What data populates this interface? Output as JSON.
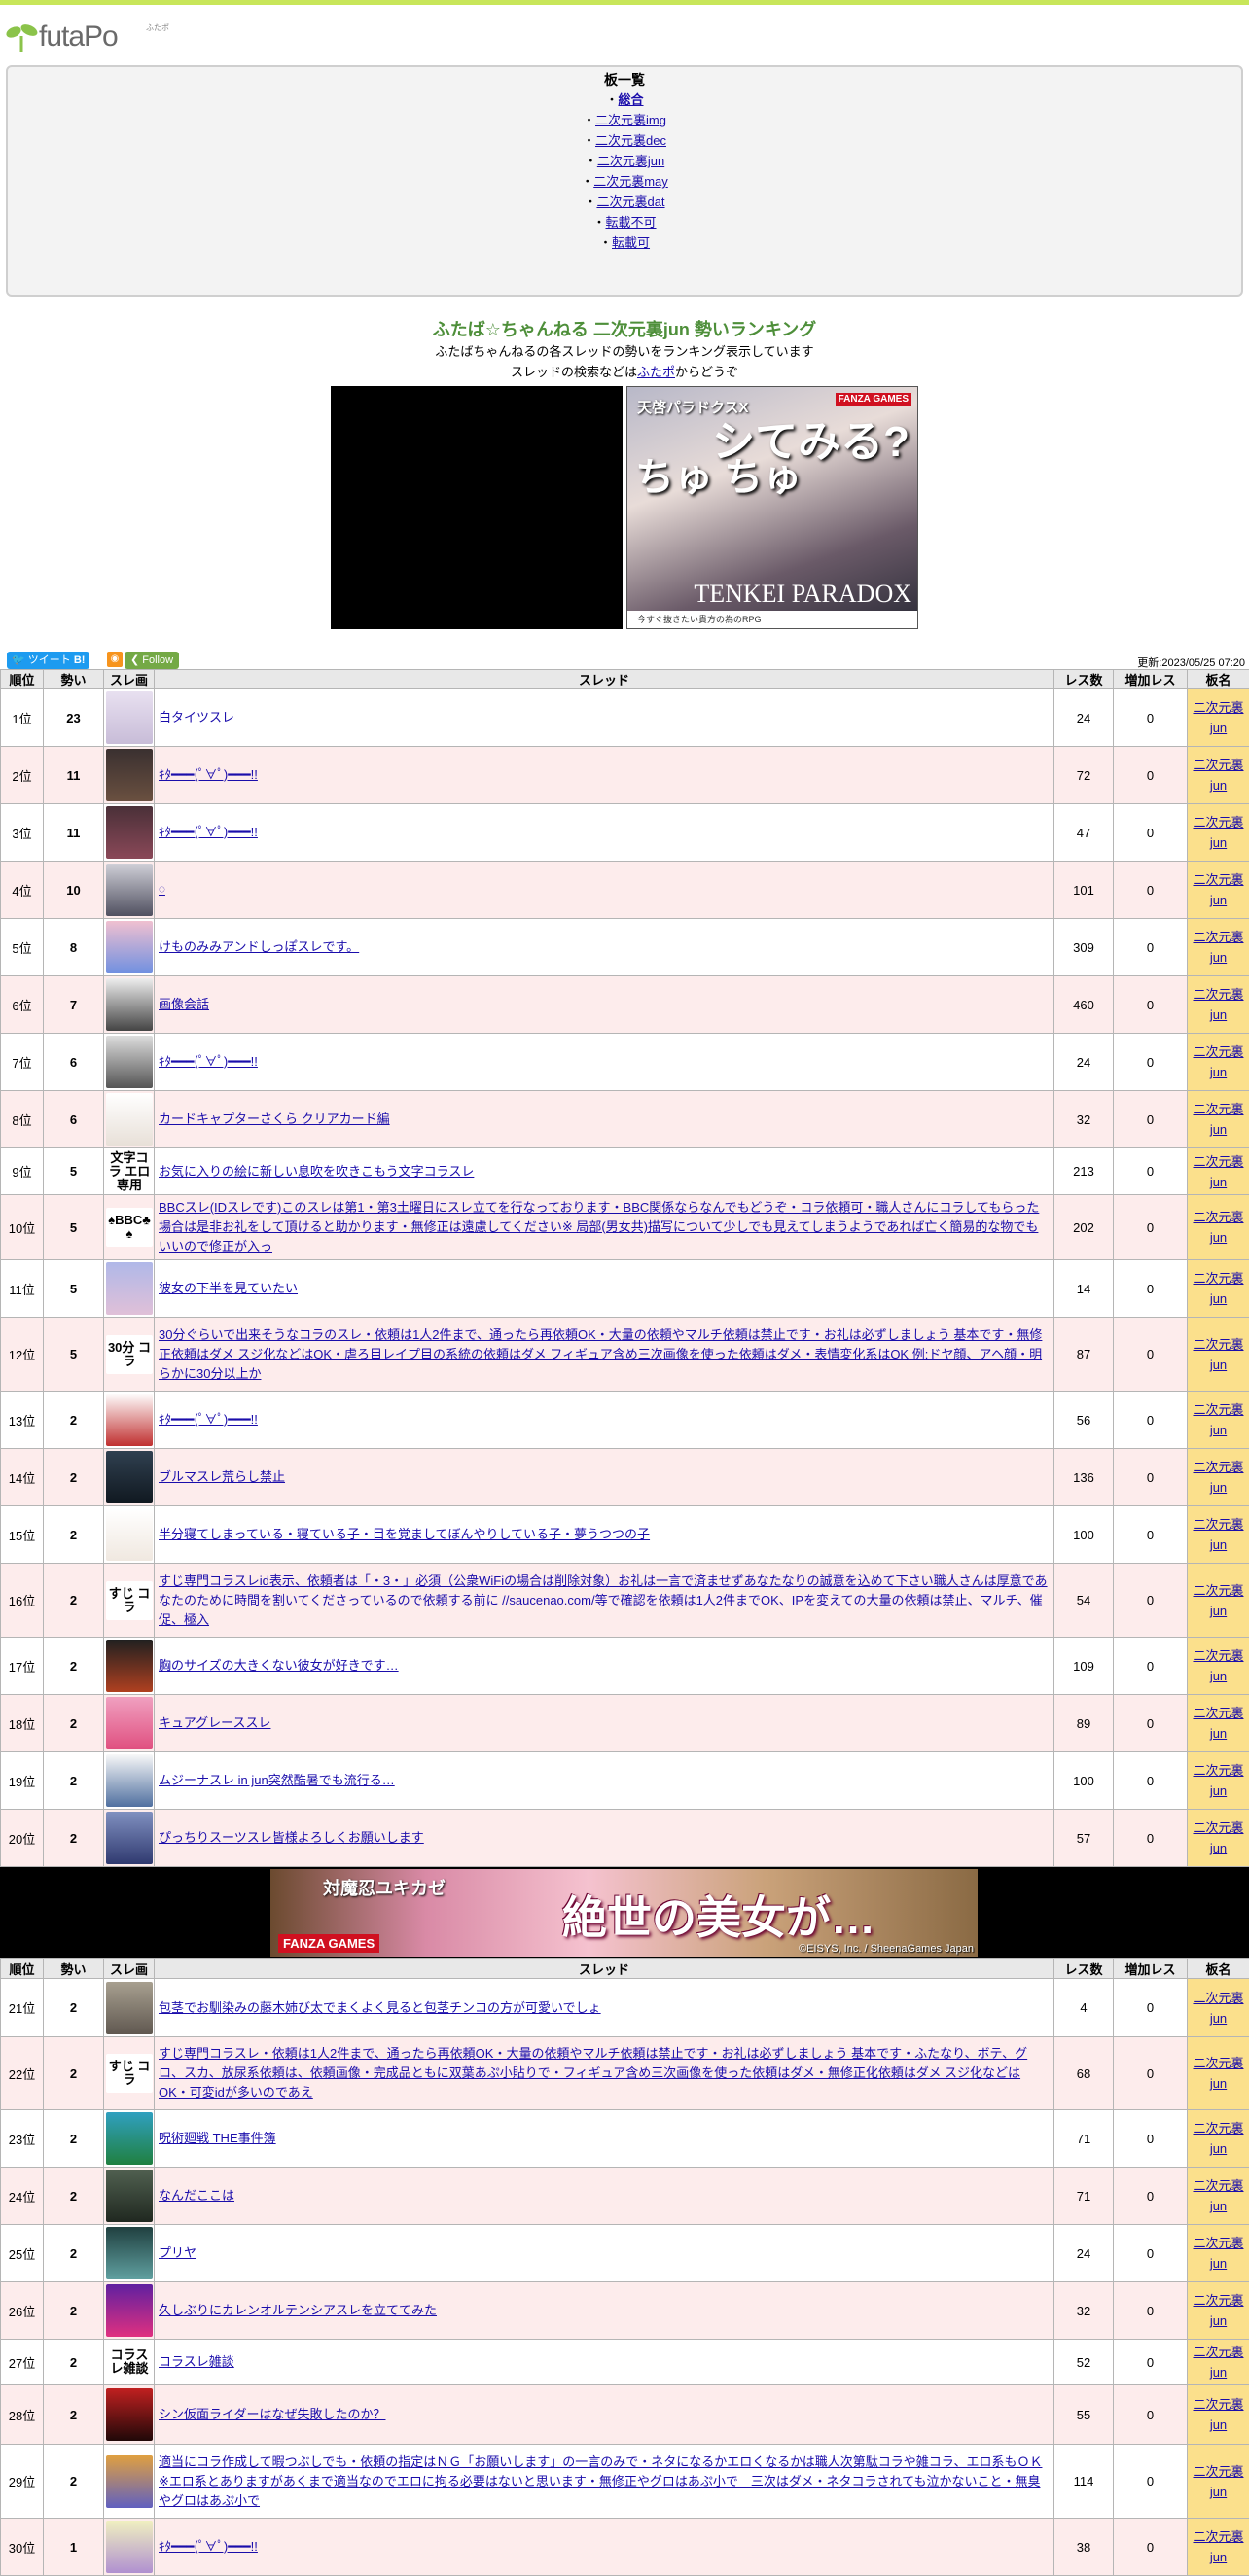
{
  "site": {
    "logo_text": "futaPo",
    "logo_sub": "ふたポ",
    "accent_color": "#c8e65a"
  },
  "boards": {
    "title": "板一覧",
    "items": [
      {
        "label": "総合",
        "active": true
      },
      {
        "label": "二次元裏img"
      },
      {
        "label": "二次元裏dec"
      },
      {
        "label": "二次元裏jun"
      },
      {
        "label": "二次元裏may"
      },
      {
        "label": "二次元裏dat"
      },
      {
        "label": "転載不可"
      },
      {
        "label": "転載可"
      }
    ]
  },
  "intro": {
    "title": "ふたば☆ちゃんねる 二次元裏jun 勢いランキング",
    "line1": "ふたばちゃんねるの各スレッドの勢いをランキング表示しています",
    "line2_pre": "スレッドの検索などは",
    "line2_link": "ふたポ",
    "line2_post": "からどうぞ"
  },
  "ad_top": {
    "brand": "天啓パラドクスX",
    "badge": "FANZA GAMES",
    "text_left": "ちゅ ちゅ",
    "text_right": "シてみる?",
    "logo": "TENKEI PARADOX",
    "caption": "今すぐ抜きたい貴方の為のRPG"
  },
  "social": {
    "tweet": "ツイート",
    "hatena": "B!",
    "rss": "rss",
    "follow": "Follow",
    "updated": "更新:2023/05/25 07:20"
  },
  "table": {
    "headers": [
      "順位",
      "勢い",
      "スレ画",
      "スレッド",
      "レス数",
      "増加レス",
      "板名"
    ],
    "rows": [
      {
        "rank": "1位",
        "mom": "23",
        "thread": "白タイツスレ",
        "res": "24",
        "inc": "0",
        "board": "二次元裏jun"
      },
      {
        "rank": "2位",
        "mom": "11",
        "thread": "ｷﾀ━━━(ﾟ∀ﾟ)━━━!!",
        "res": "72",
        "inc": "0",
        "board": "二次元裏jun"
      },
      {
        "rank": "3位",
        "mom": "11",
        "thread": "ｷﾀ━━━(ﾟ∀ﾟ)━━━!!",
        "res": "47",
        "inc": "0",
        "board": "二次元裏jun"
      },
      {
        "rank": "4位",
        "mom": "10",
        "thread": "𓏸",
        "res": "101",
        "inc": "0",
        "board": "二次元裏jun"
      },
      {
        "rank": "5位",
        "mom": "8",
        "thread": "けものみみアンドしっぽスレです。",
        "res": "309",
        "inc": "0",
        "board": "二次元裏jun"
      },
      {
        "rank": "6位",
        "mom": "7",
        "thread": "画像会話",
        "res": "460",
        "inc": "0",
        "board": "二次元裏jun"
      },
      {
        "rank": "7位",
        "mom": "6",
        "thread": "ｷﾀ━━━(ﾟ∀ﾟ)━━━!!",
        "res": "24",
        "inc": "0",
        "board": "二次元裏jun"
      },
      {
        "rank": "8位",
        "mom": "6",
        "thread": "カードキャプターさくら クリアカード編",
        "res": "32",
        "inc": "0",
        "board": "二次元裏jun"
      },
      {
        "rank": "9位",
        "mom": "5",
        "thread": "お気に入りの絵に新しい息吹を吹きこもう文字コラスレ",
        "res": "213",
        "inc": "0",
        "board": "二次元裏jun"
      },
      {
        "rank": "10位",
        "mom": "5",
        "thread": "BBCスレ(IDスレです)このスレは第1・第3土曜日にスレ立てを行なっております・BBC関係ならなんでもどうぞ・コラ依頼可・職人さんにコラしてもらった場合は是非お礼をして頂けると助かります・無修正は遠慮してください※ 局部(男女共)描写について少しでも見えてしまうようであれば亡く簡易的な物でもいいので修正が入っ",
        "res": "202",
        "inc": "0",
        "board": "二次元裏jun"
      },
      {
        "rank": "11位",
        "mom": "5",
        "thread": "彼女の下半を見ていたい",
        "res": "14",
        "inc": "0",
        "board": "二次元裏jun"
      },
      {
        "rank": "12位",
        "mom": "5",
        "thread": "30分ぐらいで出来そうなコラのスレ・依頼は1人2件まで、通ったら再依頼OK・大量の依頼やマルチ依頼は禁止です・お礼は必ずしましょう 基本です・無修正依頼はダメ スジ化などはOK・虐ろ目レイプ目の系統の依頼はダメ フィギュア含め三次画像を使った依頼はダメ・表情変化系はOK 例:ドヤ顔、アヘ顔・明らかに30分以上か",
        "res": "87",
        "inc": "0",
        "board": "二次元裏jun"
      },
      {
        "rank": "13位",
        "mom": "2",
        "thread": "ｷﾀ━━━(ﾟ∀ﾟ)━━━!!",
        "res": "56",
        "inc": "0",
        "board": "二次元裏jun"
      },
      {
        "rank": "14位",
        "mom": "2",
        "thread": "ブルマスレ荒らし禁止",
        "res": "136",
        "inc": "0",
        "board": "二次元裏jun"
      },
      {
        "rank": "15位",
        "mom": "2",
        "thread": "半分寝てしまっている・寝ている子・目を覚ましてぼんやりしている子・夢うつつの子",
        "res": "100",
        "inc": "0",
        "board": "二次元裏jun"
      },
      {
        "rank": "16位",
        "mom": "2",
        "thread": "すじ専門コラスレid表示、依頼者は「・3・」必須（公衆WiFiの場合は削除対象）お礼は一言で済ませずあなたなりの誠意を込めて下さい職人さんは厚意であなたのために時間を割いてくださっているので依頼する前に //saucenao.com/等で確認を依頼は1人2件までOK、IPを変えての大量の依頼は禁止、マルチ、催促、極入",
        "res": "54",
        "inc": "0",
        "board": "二次元裏jun"
      },
      {
        "rank": "17位",
        "mom": "2",
        "thread": "胸のサイズの大きくない彼女が好きです…",
        "res": "109",
        "inc": "0",
        "board": "二次元裏jun"
      },
      {
        "rank": "18位",
        "mom": "2",
        "thread": "キュアグレーススレ",
        "res": "89",
        "inc": "0",
        "board": "二次元裏jun"
      },
      {
        "rank": "19位",
        "mom": "2",
        "thread": "ムジーナスレ in jun突然酷暑でも流行る…",
        "res": "100",
        "inc": "0",
        "board": "二次元裏jun"
      },
      {
        "rank": "20位",
        "mom": "2",
        "thread": "ぴっちりスーツスレ皆様よろしくお願いします",
        "res": "57",
        "inc": "0",
        "board": "二次元裏jun"
      }
    ],
    "rows2": [
      {
        "rank": "21位",
        "mom": "2",
        "thread": "包茎でお馴染みの藤木姉び太でまくよく見ると包茎チンコの方が可愛いでしょ",
        "res": "4",
        "inc": "0",
        "board": "二次元裏jun"
      },
      {
        "rank": "22位",
        "mom": "2",
        "thread": "すじ専門コラスレ・依頼は1人2件まで、通ったら再依頼OK・大量の依頼やマルチ依頼は禁止です・お礼は必ずしましょう 基本です・ふたなり、ボテ、グロ、スカ、放尿系依頼は、依頼画像・完成品ともに双葉あぷ小貼りで・フィギュア含め三次画像を使った依頼はダメ・無修正化依頼はダメ スジ化などはOK・可変idが多いのであえ",
        "res": "68",
        "inc": "0",
        "board": "二次元裏jun"
      },
      {
        "rank": "23位",
        "mom": "2",
        "thread": "呪術廻戦 THE事件簿",
        "res": "71",
        "inc": "0",
        "board": "二次元裏jun"
      },
      {
        "rank": "24位",
        "mom": "2",
        "thread": "なんだここは",
        "res": "71",
        "inc": "0",
        "board": "二次元裏jun"
      },
      {
        "rank": "25位",
        "mom": "2",
        "thread": "プリヤ",
        "res": "24",
        "inc": "0",
        "board": "二次元裏jun"
      },
      {
        "rank": "26位",
        "mom": "2",
        "thread": "久しぶりにカレンオルテンシアスレを立ててみた",
        "res": "32",
        "inc": "0",
        "board": "二次元裏jun"
      },
      {
        "rank": "27位",
        "mom": "2",
        "thread": "コラスレ雑談",
        "res": "52",
        "inc": "0",
        "board": "二次元裏jun"
      },
      {
        "rank": "28位",
        "mom": "2",
        "thread": "シン仮面ライダーはなぜ失敗したのか？",
        "res": "55",
        "inc": "0",
        "board": "二次元裏jun"
      },
      {
        "rank": "29位",
        "mom": "2",
        "thread": "適当にコラ作成して暇つぶしでも・依頼の指定はＮＧ「お願いします」の一言のみで・ネタになるかエロくなるかは職人次第駄コラや雑コラ、エロ系もＯＫ※エロ系とありますがあくまで適当なのでエロに拘る必要はないと思います・無修正やグロはあぷ小で　三次はダメ・ネタコラされても泣かないこと・無臭やグロはあぷ小で",
        "res": "114",
        "inc": "0",
        "board": "二次元裏jun"
      },
      {
        "rank": "30位",
        "mom": "1",
        "thread": "ｷﾀ━━━(ﾟ∀ﾟ)━━━!!",
        "res": "38",
        "inc": "0",
        "board": "二次元裏jun"
      }
    ]
  },
  "ad_mid": {
    "brand": "対魔忍ユキカゼ",
    "badge": "FANZA GAMES",
    "headline": "絶世の美女が…",
    "copyright": "©EISYS, Inc. / SheenaGames Japan"
  }
}
